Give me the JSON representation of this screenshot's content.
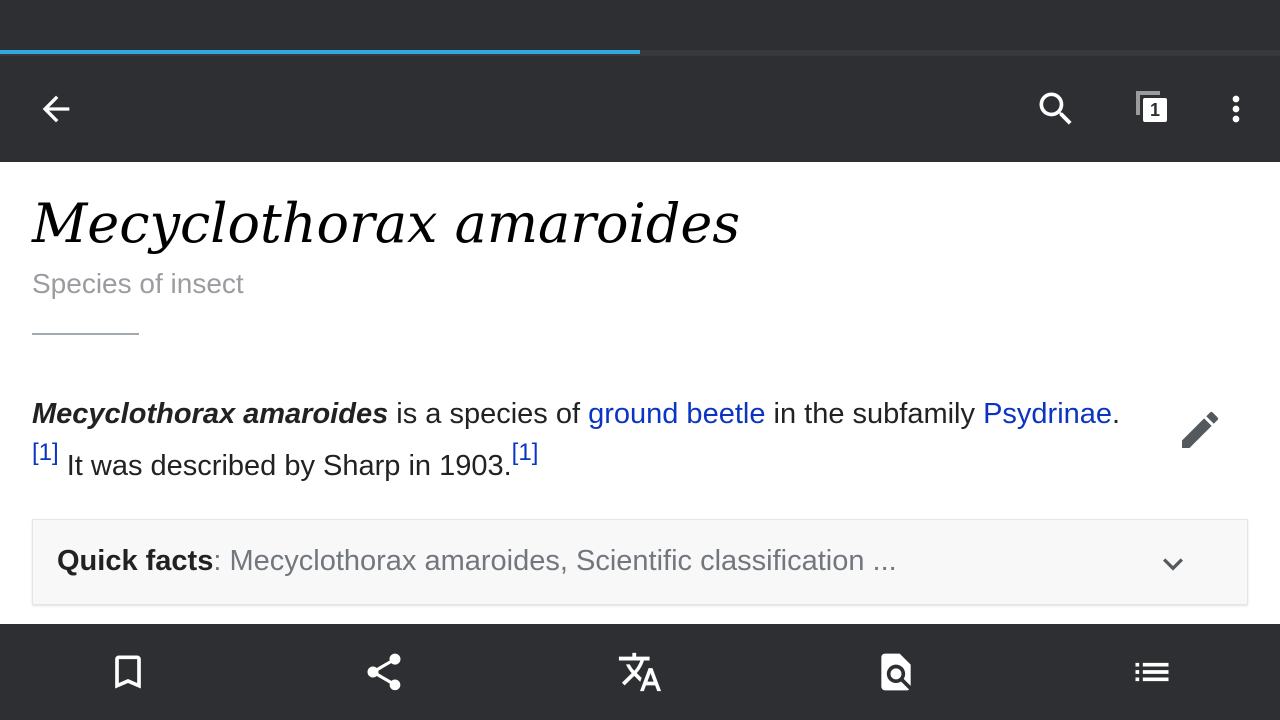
{
  "progress": {
    "percent": 50
  },
  "toolbar": {
    "back_icon": "arrow-back-icon",
    "search_icon": "search-icon",
    "tabs_icon": "tabs-icon",
    "tab_count": "1",
    "more_icon": "more-vert-icon"
  },
  "article": {
    "title": "Mecyclothorax amaroides",
    "description": "Species of insect",
    "intro": {
      "bold_name": "Mecyclothorax amaroides",
      "text1": " is a species of ",
      "link1": "ground beetle",
      "text2": " in the subfamily ",
      "link2": "Psydrinae",
      "text3": ".",
      "ref1": "[1]",
      "text4": " It was described by Sharp in 1903.",
      "ref2": "[1]"
    },
    "edit_icon": "pencil-icon"
  },
  "quick_facts": {
    "label": "Quick facts",
    "separator": ": ",
    "summary": "Mecyclothorax amaroides, Scientific classification ...",
    "chevron_icon": "chevron-down-icon"
  },
  "bottom_bar": {
    "items": [
      {
        "icon": "bookmark-icon"
      },
      {
        "icon": "share-icon"
      },
      {
        "icon": "translate-icon"
      },
      {
        "icon": "find-in-page-icon"
      },
      {
        "icon": "contents-list-icon"
      }
    ]
  },
  "colors": {
    "chrome": "#2d2f32",
    "progress": "#33a9de",
    "link": "#0b34c2",
    "text": "#222222",
    "muted": "#72777d"
  }
}
